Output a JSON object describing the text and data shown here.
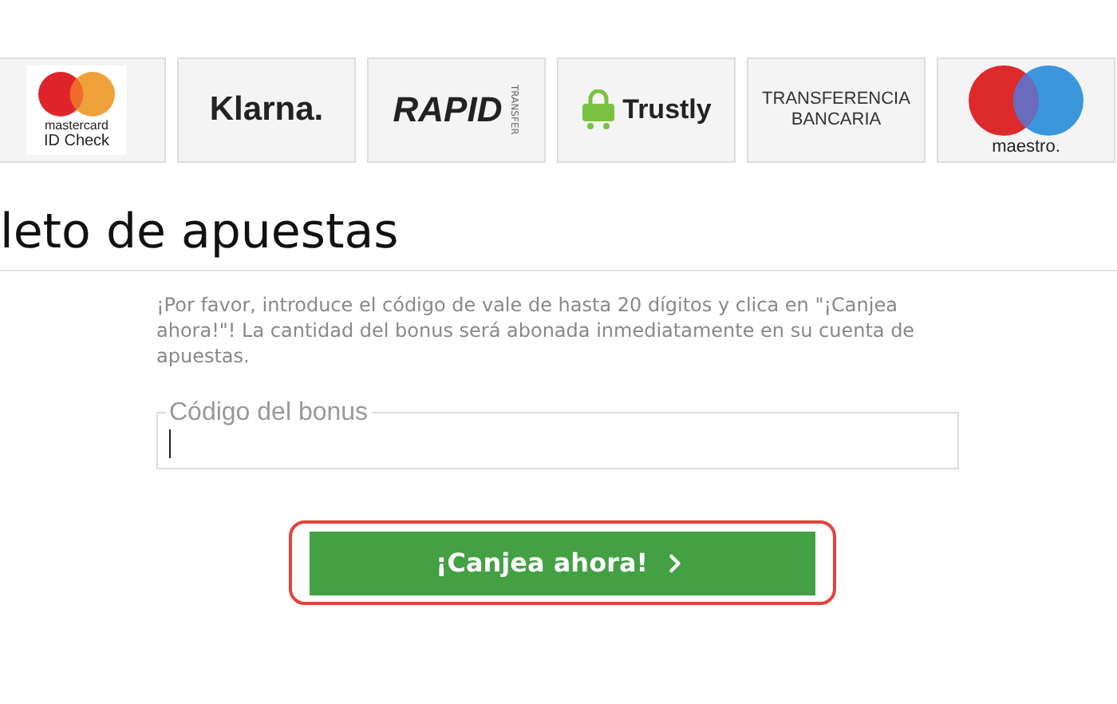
{
  "payment_methods": [
    {
      "kind": "mastercard",
      "lines": [
        "mastercard",
        "ID Check"
      ]
    },
    {
      "kind": "klarna",
      "lines": [
        "Klarna."
      ]
    },
    {
      "kind": "rapid",
      "lines": [
        "RAPID",
        "TRANSFER"
      ]
    },
    {
      "kind": "trustly",
      "lines": [
        "Trustly"
      ]
    },
    {
      "kind": "text",
      "lines": [
        "TRANSFERENCIA",
        "BANCARIA"
      ]
    },
    {
      "kind": "maestro",
      "lines": [
        "maestro."
      ]
    }
  ],
  "heading": "leto de apuestas",
  "instructions": "¡Por favor, introduce el código de vale de hasta 20 dígitos y clica en \"¡Canjea ahora!\"! La cantidad del bonus será abonada inmediatamente en su cuenta de apuestas.",
  "bonus_field": {
    "label": "Código del bonus"
  },
  "redeem_button": {
    "label": "¡Canjea ahora!",
    "highlighted": true
  }
}
